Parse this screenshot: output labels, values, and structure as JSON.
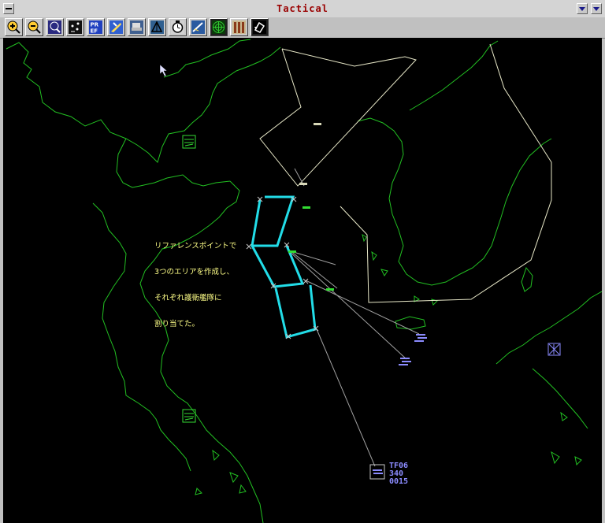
{
  "window": {
    "title": "Tactical"
  },
  "toolbar": {
    "tools": [
      {
        "name": "zoom-in-icon"
      },
      {
        "name": "zoom-out-icon"
      },
      {
        "name": "zoom-fit-icon"
      },
      {
        "name": "reference-point-icon"
      },
      {
        "name": "pref-icon",
        "label": "PR EF"
      },
      {
        "name": "aircraft-icon"
      },
      {
        "name": "ship-icon"
      },
      {
        "name": "formation-icon"
      },
      {
        "name": "clock-icon"
      },
      {
        "name": "missile-icon"
      },
      {
        "name": "radar-icon"
      },
      {
        "name": "columns-icon"
      },
      {
        "name": "return-icon"
      }
    ]
  },
  "map": {
    "annotation": {
      "lines": [
        "リファレンスポイントで",
        "3つのエリアを作成し、",
        "それぞれ護衛艦隊に",
        "割り当てた。"
      ]
    },
    "task_force": {
      "id": "TF06",
      "heading": "340",
      "time": "0015"
    },
    "colors": {
      "background": "#000000",
      "coast": "#22c022",
      "zone": "#e8e8c8",
      "area": "#22dde8",
      "track": "#a0a0a0",
      "unit": "#8c8cff",
      "annotation": "#ffff88"
    }
  }
}
